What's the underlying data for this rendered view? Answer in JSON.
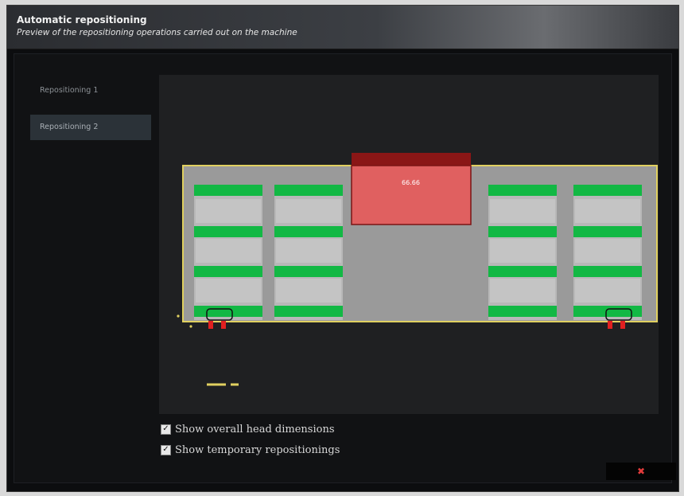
{
  "window": {
    "title": "Automatic repositioning",
    "subtitle": "Preview of the repositioning operations carried out on the machine"
  },
  "sidebar": {
    "items": [
      {
        "label": "Repositioning 1",
        "active": false
      },
      {
        "label": "Repositioning 2",
        "active": true
      }
    ]
  },
  "preview": {
    "workpiece_color": "#9a9a9a",
    "workpiece_border": "#e0d060",
    "suction_cup_color": "#12b844",
    "pod_color": "#b8b8b8",
    "head_color": "#e06060",
    "head_top_color": "#8a1616",
    "head_label": "66.66",
    "clamp_color": "#e02020",
    "scale_color": "#e0d060"
  },
  "options": {
    "show_head_dimensions": {
      "label": "Show overall head dimensions",
      "checked": true
    },
    "show_temporary": {
      "label": "Show temporary repositionings",
      "checked": true
    }
  },
  "footer": {
    "close_icon": "close-icon"
  }
}
